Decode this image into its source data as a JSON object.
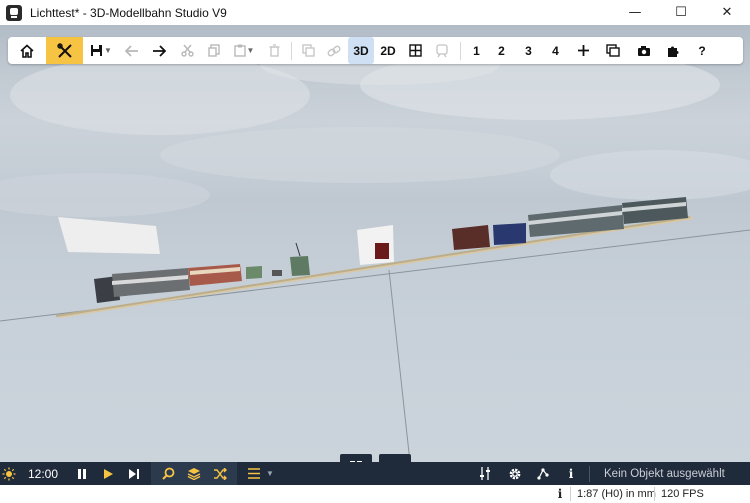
{
  "window": {
    "title": "Lichttest* - 3D-Modellbahn Studio V9",
    "app_icon": "train-app-icon",
    "controls": {
      "minimize": "—",
      "maximize": "☐",
      "close": "✕"
    }
  },
  "toolbar": {
    "home": "home-icon",
    "tools": "tools-icon",
    "save": "save-icon",
    "back": "arrow-left-icon",
    "forward": "arrow-right-icon",
    "cut": "cut-icon",
    "copy": "copy-icon",
    "paste": "paste-icon",
    "delete": "trash-icon",
    "duplicate": "duplicate-icon",
    "link": "link-icon",
    "view_3d": "3D",
    "view_2d": "2D",
    "grid": "grid-icon",
    "train": "train-icon",
    "layer_1": "1",
    "layer_2": "2",
    "layer_3": "3",
    "layer_4": "4",
    "add": "plus-icon",
    "window": "window-icon",
    "camera": "camera-icon",
    "plugin": "puzzle-icon",
    "help": "?"
  },
  "bottombar": {
    "time": "12:00",
    "pause": "pause-icon",
    "play": "play-icon",
    "step": "step-forward-icon",
    "search": "search-icon",
    "layers": "layers-icon",
    "shuffle": "shuffle-icon",
    "list": "list-icon",
    "mixer": "sliders-icon",
    "settings": "gear-icon",
    "graph": "graph-icon",
    "info": "i",
    "status": "Kein Objekt ausgewählt"
  },
  "statusbar": {
    "info": "i",
    "scale": "1:87 (H0) in mm",
    "fps": "120 FPS"
  },
  "colors": {
    "accent_yellow": "#f6c343",
    "bar_bg": "#1f2a3a",
    "active_3d": "#cfe0f5"
  }
}
